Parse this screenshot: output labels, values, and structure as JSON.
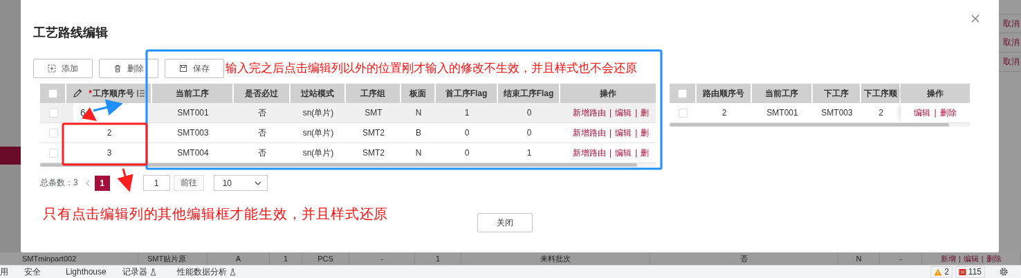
{
  "dialog": {
    "title": "工艺路线编辑",
    "toolbar": [
      {
        "kind": "add",
        "label": "添加"
      },
      {
        "kind": "delete",
        "label": "删除"
      },
      {
        "kind": "save",
        "label": "保存"
      }
    ],
    "route_table": {
      "all_checked": false,
      "action_separator": "|",
      "columns": [
        {
          "label": "工序顺序号",
          "required_mark": "*",
          "editable": true
        },
        {
          "label": "当前工序"
        },
        {
          "label": "是否必过"
        },
        {
          "label": "过站模式"
        },
        {
          "label": "工序组"
        },
        {
          "label": "板面"
        },
        {
          "label": "首工序Flag"
        },
        {
          "label": "结束工序Flag"
        },
        {
          "label": "操作"
        }
      ],
      "rows": [
        {
          "checked": false,
          "editing": true,
          "cells": [
            "6",
            "SMT001",
            "否",
            "sn(单片)",
            "SMT",
            "N",
            "1",
            "0"
          ],
          "actions": [
            "新增路由",
            "编辑",
            "删"
          ]
        },
        {
          "checked": false,
          "editing": false,
          "cells": [
            "2",
            "SMT003",
            "否",
            "sn(单片)",
            "SMT2",
            "B",
            "0",
            "0"
          ],
          "actions": [
            "新增路由",
            "编辑",
            "删"
          ]
        },
        {
          "checked": false,
          "editing": false,
          "cells": [
            "3",
            "SMT004",
            "否",
            "sn(单片)",
            "SMT2",
            "N",
            "0",
            "1"
          ],
          "actions": [
            "新增路由",
            "编辑",
            "删"
          ]
        }
      ]
    },
    "next_table": {
      "all_checked": false,
      "action_separator": "|",
      "columns": [
        {
          "label": "路由顺序号"
        },
        {
          "label": "当前工序"
        },
        {
          "label": "下工序"
        },
        {
          "label": "下工序顺"
        },
        {
          "label": "操作"
        }
      ],
      "rows": [
        {
          "checked": false,
          "editing": false,
          "cells": [
            "2",
            "SMT001",
            "SMT003",
            "2"
          ],
          "actions": [
            "编辑",
            "删除"
          ]
        }
      ]
    },
    "pagination": {
      "total": "总条数：3",
      "pages": [
        {
          "label": "1",
          "selected": true
        }
      ],
      "goto_value": "1",
      "goto_button": "前往",
      "page_size": "10"
    },
    "close_button": "关闭"
  },
  "notes": [
    {
      "text": "输入完之后点击编辑列以外的位置刚才输入的修改不生效，并且样式也不会还原"
    },
    {
      "text": "只有点击编辑列的其他编辑框才能生效，并且样式还原"
    }
  ],
  "background": {
    "side_links": [
      "取消",
      "取消",
      "取消"
    ],
    "row": [
      "SMTminpart002",
      "SMT贴片原",
      "A",
      "1",
      "PCS",
      "-",
      "1",
      "来料批次",
      "否",
      "N",
      "-"
    ],
    "row_actions": [
      "新增",
      "编辑",
      "删除"
    ],
    "row_separator": "|"
  },
  "devtools": {
    "tabs": [
      {
        "label": "用",
        "experimental": false
      },
      {
        "label": "安全",
        "experimental": false
      },
      {
        "label": "Lighthouse",
        "experimental": false
      },
      {
        "label": "记录器",
        "experimental": true
      },
      {
        "label": "性能数据分析",
        "experimental": true
      }
    ],
    "warnings": "2",
    "errors": "115"
  }
}
